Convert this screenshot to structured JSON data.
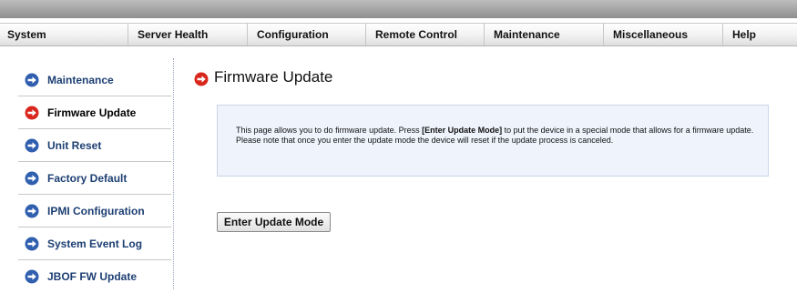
{
  "menu": {
    "items": [
      {
        "label": "System"
      },
      {
        "label": "Server Health"
      },
      {
        "label": "Configuration"
      },
      {
        "label": "Remote Control"
      },
      {
        "label": "Maintenance"
      },
      {
        "label": "Miscellaneous"
      },
      {
        "label": "Help"
      }
    ]
  },
  "sidebar": {
    "items": [
      {
        "label": "Maintenance",
        "icon": "arrow-right-circle-blue",
        "active": false
      },
      {
        "label": "Firmware Update",
        "icon": "arrow-right-circle-red",
        "active": true
      },
      {
        "label": "Unit Reset",
        "icon": "arrow-right-circle-blue",
        "active": false
      },
      {
        "label": "Factory Default",
        "icon": "arrow-right-circle-blue",
        "active": false
      },
      {
        "label": "IPMI Configuration",
        "icon": "arrow-right-circle-blue",
        "active": false
      },
      {
        "label": "System Event Log",
        "icon": "arrow-right-circle-blue",
        "active": false
      },
      {
        "label": "JBOF FW Update",
        "icon": "arrow-right-circle-blue",
        "active": false
      }
    ]
  },
  "main": {
    "title": "Firmware Update",
    "title_icon": "arrow-right-circle-red",
    "info": {
      "line1_pre": "This page allows you to do firmware update. Press ",
      "line1_bold": "[Enter Update Mode]",
      "line1_post": " to put the device in a special mode that allows for a firmware update.",
      "line2": "Please note that once you enter the update mode the device will reset if the update process is canceled."
    },
    "button_label": "Enter Update Mode"
  },
  "colors": {
    "icon_blue": "#2f5fae",
    "icon_red": "#d9261c",
    "sidebar_text": "#1d3f73",
    "info_bg": "#eef3fc"
  }
}
